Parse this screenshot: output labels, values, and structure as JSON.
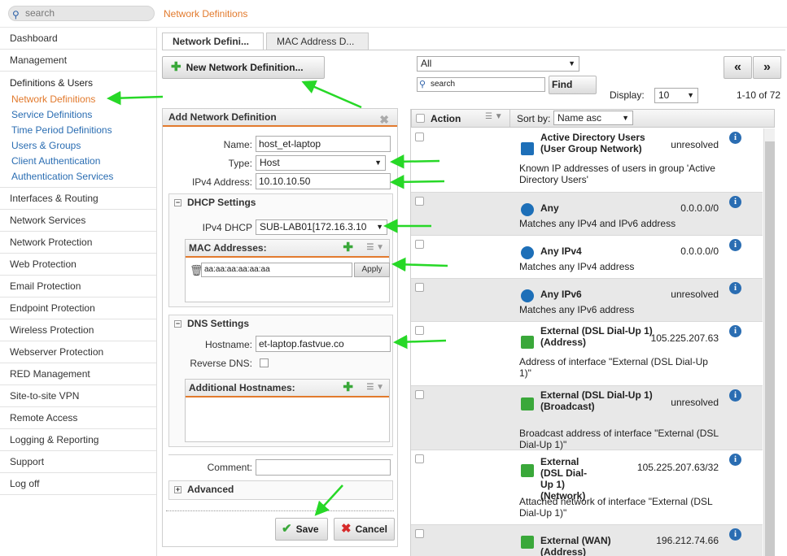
{
  "topbar": {
    "search_placeholder": "search",
    "breadcrumb": "Network Definitions"
  },
  "sidebar": {
    "items": [
      "Dashboard",
      "Management"
    ],
    "open_section": {
      "label": "Definitions & Users",
      "subitems": [
        "Network Definitions",
        "Service Definitions",
        "Time Period Definitions",
        "Users & Groups",
        "Client Authentication",
        "Authentication Services"
      ]
    },
    "items_after": [
      "Interfaces & Routing",
      "Network Services",
      "Network Protection",
      "Web Protection",
      "Email Protection",
      "Endpoint Protection",
      "Wireless Protection",
      "Webserver Protection",
      "RED Management",
      "Site-to-site VPN",
      "Remote Access",
      "Logging & Reporting",
      "Support",
      "Log off"
    ]
  },
  "tabs": [
    "Network Defini...",
    "MAC Address D..."
  ],
  "new_button": "New Network Definition...",
  "form": {
    "title": "Add Network Definition",
    "name_label": "Name:",
    "name_value": "host_et-laptop",
    "type_label": "Type:",
    "type_value": "Host",
    "ipv4_label": "IPv4 Address:",
    "ipv4_value": "10.10.10.50",
    "dhcp_section": "DHCP Settings",
    "ipv4_dhcp_label": "IPv4 DHCP",
    "ipv4_dhcp_value": "SUB-LAB01[172.16.3.10",
    "mac_box_title": "MAC Addresses:",
    "mac_value": "aa:aa:aa:aa:aa:aa",
    "apply_label": "Apply",
    "dns_section": "DNS Settings",
    "hostname_label": "Hostname:",
    "hostname_value": "et-laptop.fastvue.co",
    "reverse_dns_label": "Reverse DNS:",
    "additional_hostnames_title": "Additional Hostnames:",
    "comment_label": "Comment:",
    "advanced_label": "Advanced",
    "save_label": "Save",
    "cancel_label": "Cancel"
  },
  "filter": {
    "value": "All",
    "search_placeholder": "search",
    "find_label": "Find",
    "display_label": "Display:",
    "display_value": "10",
    "range": "1-10 of 72"
  },
  "list": {
    "action_header": "Action",
    "sortby_label": "Sort by:",
    "sortby_value": "Name asc",
    "rows": [
      {
        "name": "Active Directory Users (User Group Network)",
        "value": "unresolved",
        "desc": "Known IP addresses of users in group 'Active Directory Users'",
        "icon": "user-group-network-icon",
        "color": "#1d6fb8"
      },
      {
        "name": "Any",
        "value": "0.0.0.0/0",
        "desc": "Matches any IPv4 and IPv6 address",
        "icon": "globe-icon",
        "color": "#1d6fb8"
      },
      {
        "name": "Any IPv4",
        "value": "0.0.0.0/0",
        "desc": "Matches any IPv4 address",
        "icon": "globe-icon",
        "color": "#1d6fb8"
      },
      {
        "name": "Any IPv6",
        "value": "unresolved",
        "desc": "Matches any IPv6 address",
        "icon": "globe-icon",
        "color": "#1d6fb8"
      },
      {
        "name": "External (DSL Dial-Up 1) (Address)",
        "value": "105.225.207.63",
        "desc": "Address of interface \"External (DSL Dial-Up 1)\"",
        "icon": "interface-icon",
        "color": "#3aa83a"
      },
      {
        "name": "External (DSL Dial-Up 1) (Broadcast)",
        "value": "unresolved",
        "desc": "Broadcast address of interface \"External (DSL Dial-Up 1)\"",
        "icon": "interface-icon",
        "color": "#3aa83a"
      },
      {
        "name": "External (DSL Dial-Up 1) (Network)",
        "value": "105.225.207.63/32",
        "desc": "Attached network of interface \"External (DSL Dial-Up 1)\"",
        "icon": "interface-icon",
        "color": "#3aa83a"
      },
      {
        "name": "External (WAN) (Address)",
        "value": "196.212.74.66",
        "desc": "",
        "icon": "interface-icon",
        "color": "#3aa83a"
      }
    ]
  },
  "colors": {
    "accent": "#e27a2d",
    "link": "#2a6db2",
    "arrow": "#27d827"
  }
}
